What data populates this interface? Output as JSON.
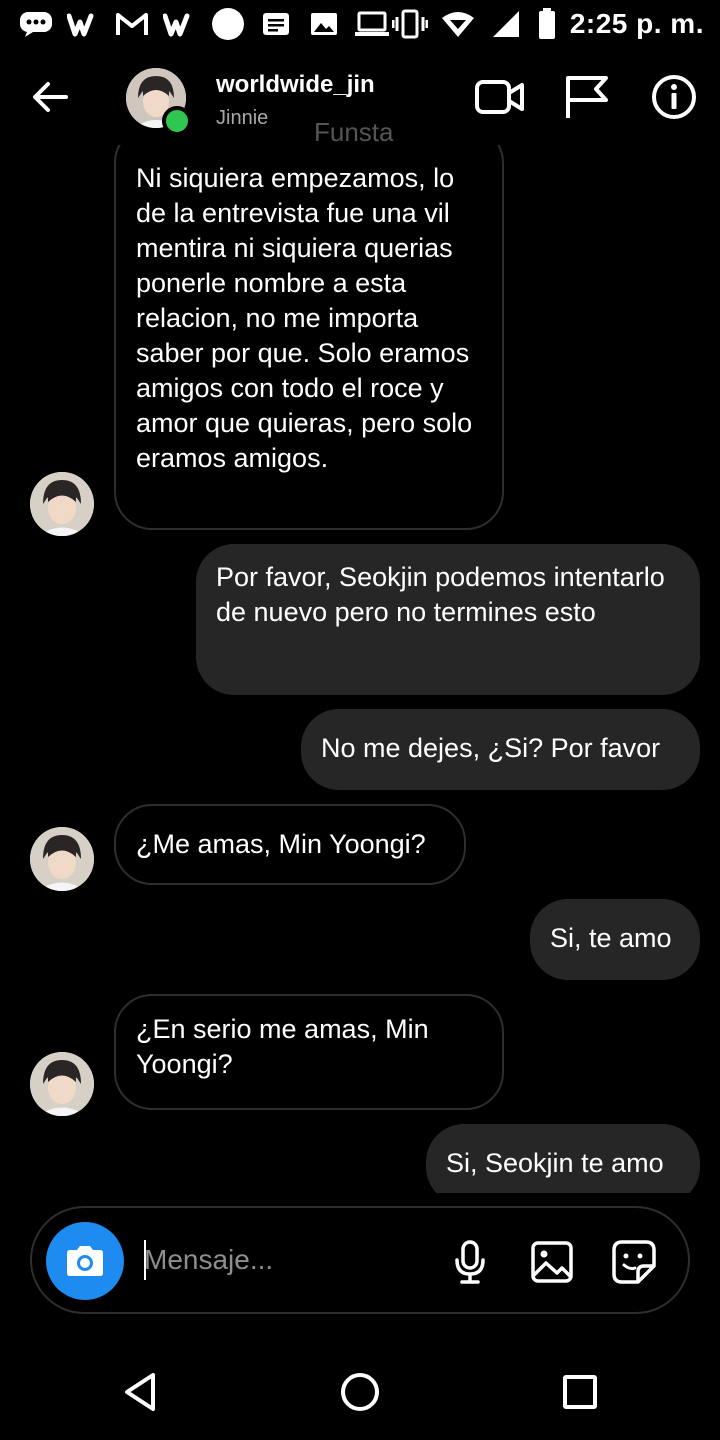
{
  "status_bar": {
    "time": "2:25 p. m.",
    "left_icons": [
      "chat-bubble-icon",
      "wattpad-icon",
      "gmail-icon",
      "wattpad-icon",
      "circle-icon",
      "document-icon",
      "image-icon",
      "laptop-icon"
    ],
    "right_icons": [
      "vibrate-icon",
      "wifi-icon",
      "signal-icon",
      "battery-icon"
    ]
  },
  "header": {
    "username": "worldwide_jin",
    "subtitle": "Jinnie",
    "overlay_text": "Funsta",
    "online": true
  },
  "messages": [
    {
      "direction": "incoming",
      "text": "Ni siquiera empezamos, lo de la entrevista fue una vil mentira ni siquiera querias ponerle nombre a esta relacion, no me importa saber por que. Solo eramos amigos con todo el roce y amor que quieras, pero solo eramos amigos."
    },
    {
      "direction": "outgoing",
      "text": "Por favor, Seokjin podemos intentarlo de nuevo pero no termines esto"
    },
    {
      "direction": "outgoing",
      "text": "No me dejes, ¿Si? Por favor"
    },
    {
      "direction": "incoming",
      "text": "¿Me amas, Min Yoongi?"
    },
    {
      "direction": "outgoing",
      "text": "Si, te amo"
    },
    {
      "direction": "incoming",
      "text": "¿En serio me amas, Min Yoongi?"
    },
    {
      "direction": "outgoing",
      "text": "Si, Seokjin te amo"
    }
  ],
  "composer": {
    "placeholder": "Mensaje...",
    "value": ""
  },
  "colors": {
    "background": "#000000",
    "outgoing_bubble": "#262626",
    "incoming_border": "#2e2e2e",
    "camera_button": "#1e8bf0",
    "online_dot": "#30c750"
  }
}
